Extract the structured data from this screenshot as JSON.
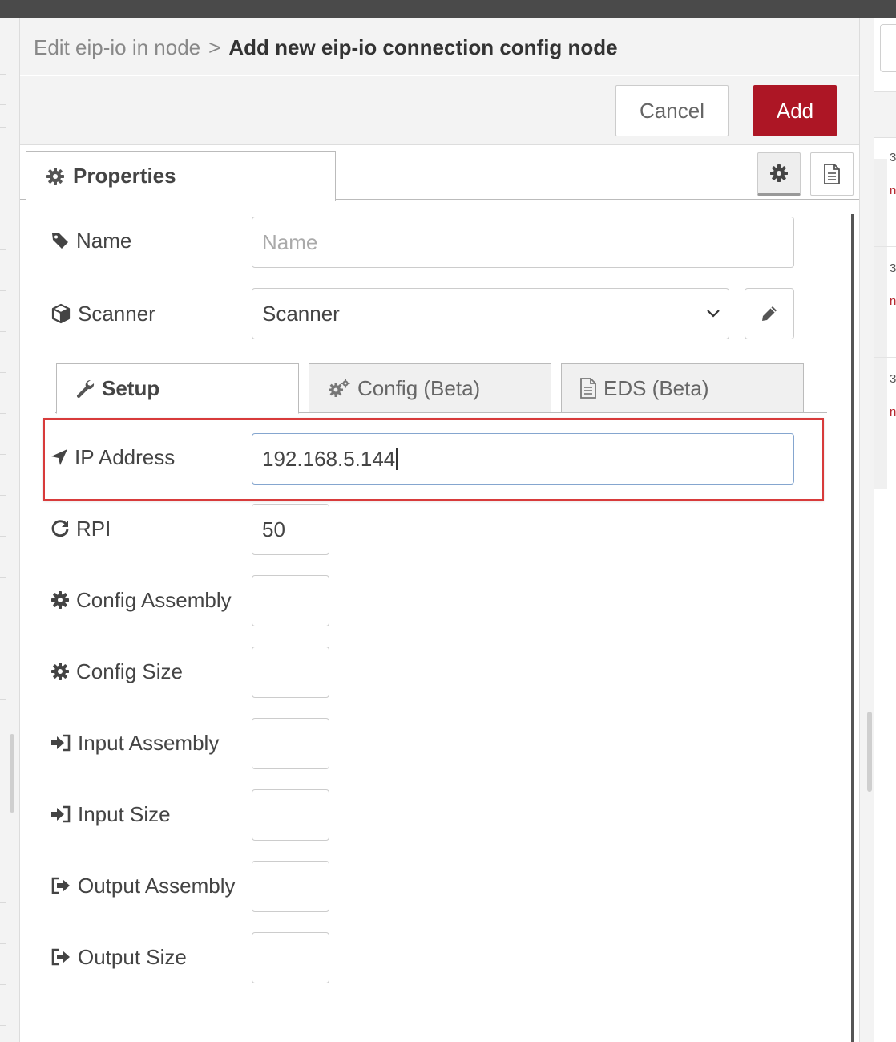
{
  "breadcrumb": {
    "parent": "Edit eip-io in node",
    "separator": ">",
    "current": "Add new eip-io connection config node"
  },
  "buttons": {
    "cancel": "Cancel",
    "add": "Add"
  },
  "tabs": {
    "properties": "Properties"
  },
  "icons": {
    "properties_tab": "gear-icon",
    "settings_button": "gear-icon",
    "description_button": "document-icon",
    "name": "tag-icon",
    "scanner": "cube-icon",
    "scanner_edit": "pencil-icon",
    "setup_tab": "wrench-icon",
    "config_tab": "gears-icon",
    "eds_tab": "document-icon",
    "ip_address": "location-arrow-icon",
    "rpi": "refresh-icon",
    "config_assembly": "gear-icon",
    "config_size": "gear-icon",
    "input_assembly": "sign-in-icon",
    "input_size": "sign-in-icon",
    "output_assembly": "sign-out-icon",
    "output_size": "sign-out-icon"
  },
  "fields": {
    "name": {
      "label": "Name",
      "placeholder": "Name",
      "value": ""
    },
    "scanner": {
      "label": "Scanner",
      "selected": "Scanner"
    }
  },
  "subtabs": {
    "setup": "Setup",
    "config": "Config (Beta)",
    "eds": "EDS (Beta)"
  },
  "setup_fields": {
    "ip_address": {
      "label": "IP Address",
      "value": "192.168.5.144"
    },
    "rpi": {
      "label": "RPI",
      "value": "50"
    },
    "config_assembly": {
      "label": "Config Assembly",
      "value": ""
    },
    "config_size": {
      "label": "Config Size",
      "value": ""
    },
    "input_assembly": {
      "label": "Input Assembly",
      "value": ""
    },
    "input_size": {
      "label": "Input Size",
      "value": ""
    },
    "output_assembly": {
      "label": "Output Assembly",
      "value": ""
    },
    "output_size": {
      "label": "Output Size",
      "value": ""
    }
  },
  "side_panel": {
    "entries": [
      {
        "number": "3",
        "tag": "n"
      },
      {
        "number": "3",
        "tag": "n"
      },
      {
        "number": "3",
        "tag": "n"
      }
    ]
  },
  "colors": {
    "accent": "#ad1625",
    "highlight": "#d83b3b",
    "focus_border": "#85a6cf"
  }
}
